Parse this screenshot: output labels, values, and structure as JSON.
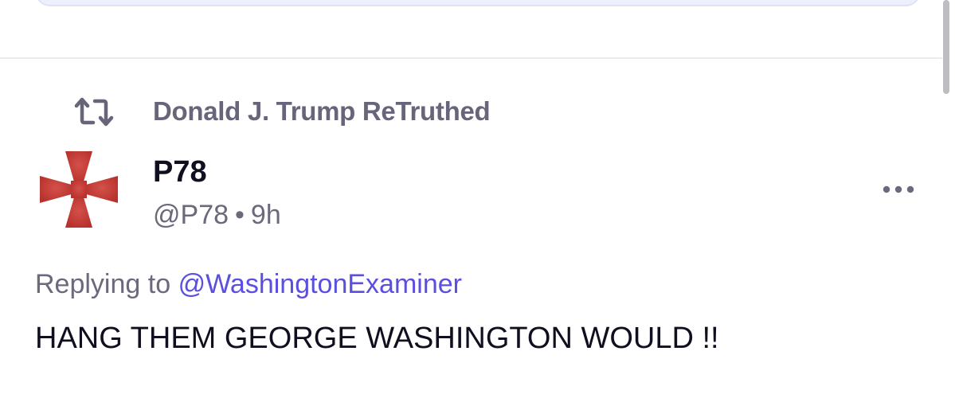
{
  "retruth": {
    "icon": "retruth-icon",
    "label": "Donald J. Trump ReTruthed"
  },
  "post": {
    "avatar_icon": "cross-pattee-icon",
    "avatar_color": "#cc3f38",
    "display_name": "P78",
    "handle": "@P78",
    "separator": "•",
    "time": "9h",
    "more_icon": "more-horizontal-icon",
    "reply_prefix": "Replying to",
    "reply_mention": "@WashingtonExaminer",
    "text": "HANG THEM GEORGE WASHINGTON WOULD !!"
  },
  "colors": {
    "accent": "#5b4fe0",
    "muted_text": "#6b6a7d",
    "primary_text": "#0f0f1f"
  }
}
